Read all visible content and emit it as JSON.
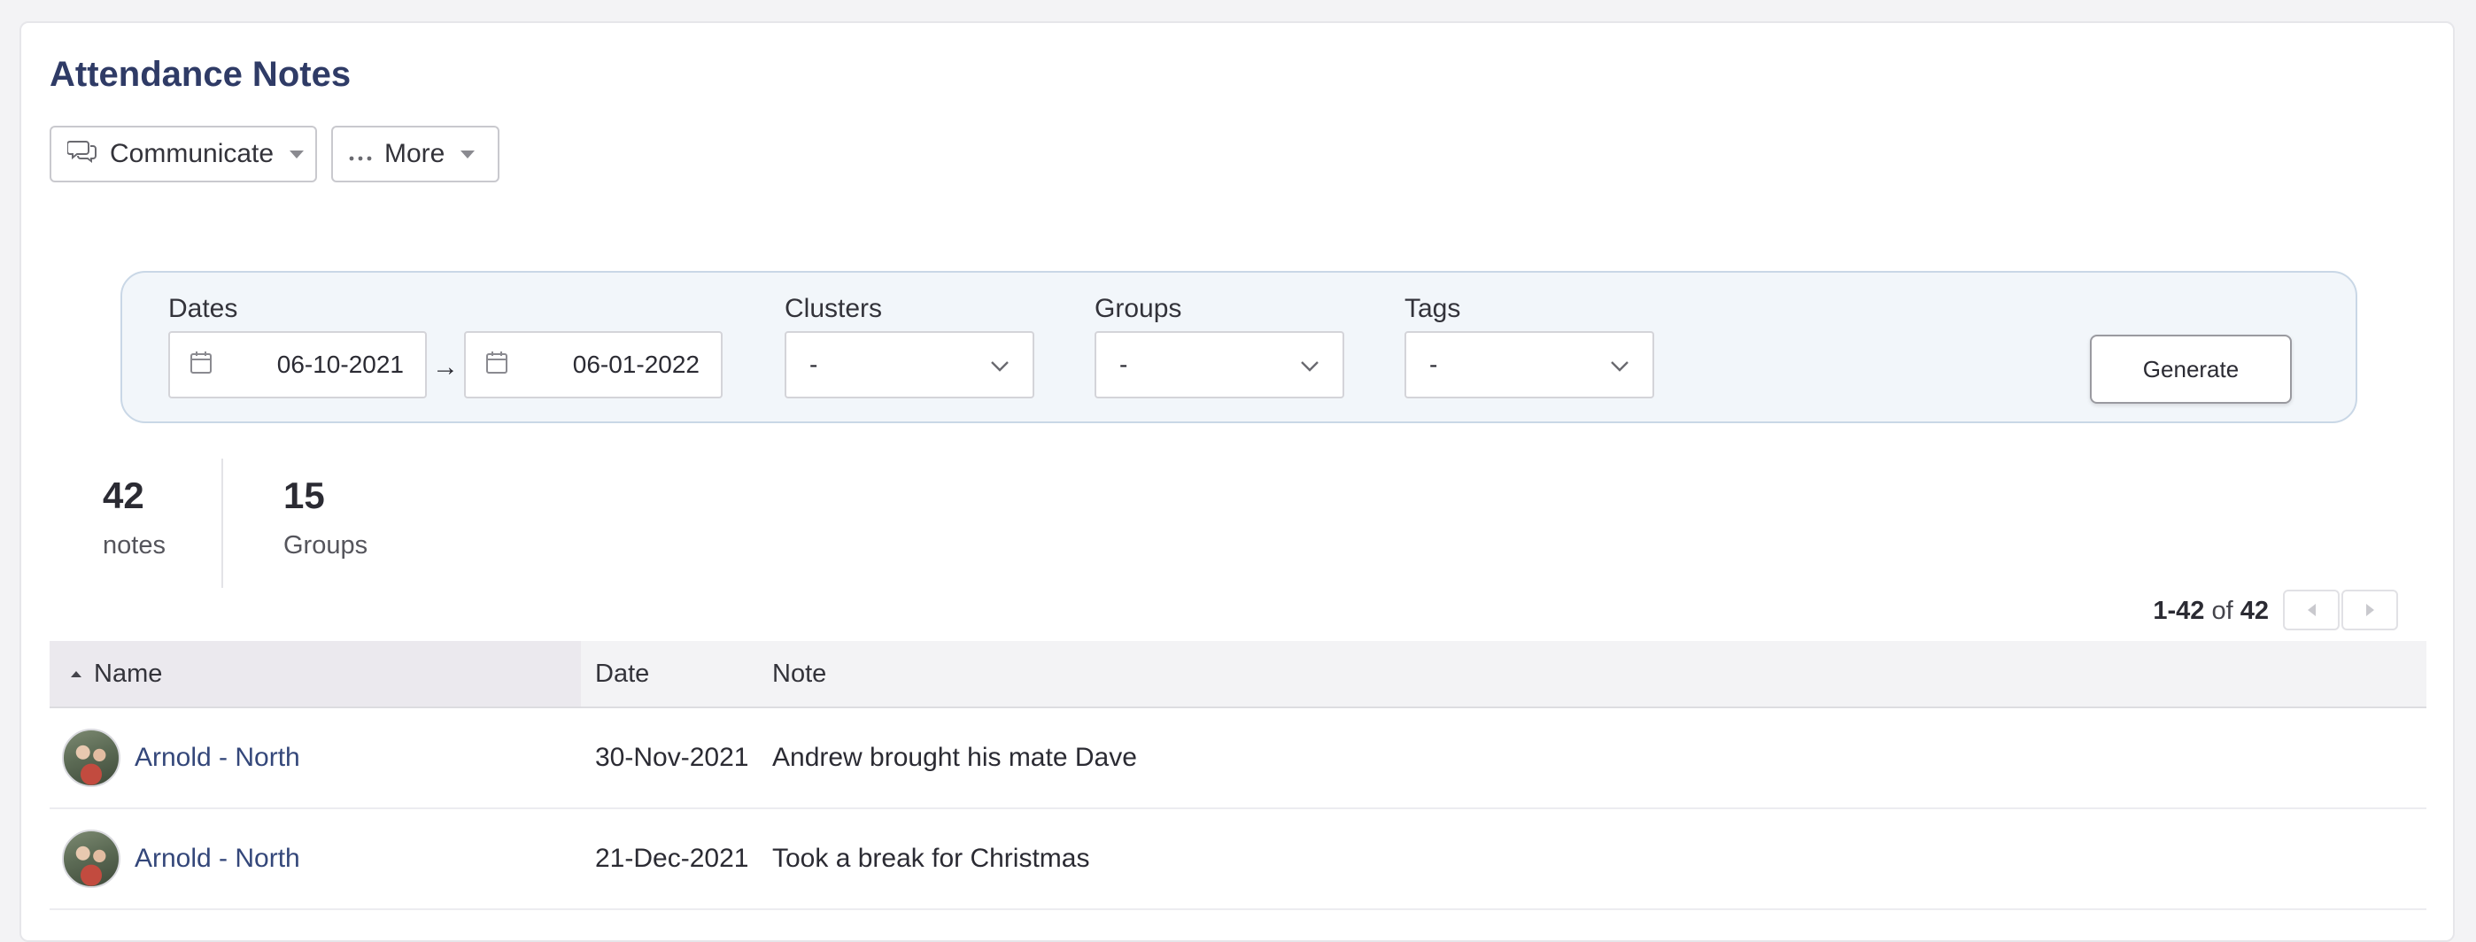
{
  "page": {
    "title": "Attendance Notes"
  },
  "toolbar": {
    "communicate_label": "Communicate",
    "more_label": "More"
  },
  "filters": {
    "dates_label": "Dates",
    "date_from": "06-10-2021",
    "date_to": "06-01-2022",
    "arrow": "→",
    "clusters_label": "Clusters",
    "clusters_value": "-",
    "groups_label": "Groups",
    "groups_value": "-",
    "tags_label": "Tags",
    "tags_value": "-",
    "generate_label": "Generate"
  },
  "stats": [
    {
      "value": "42",
      "label": "notes"
    },
    {
      "value": "15",
      "label": "Groups"
    }
  ],
  "pager": {
    "range": "1-42",
    "of": "of",
    "total": "42"
  },
  "table": {
    "columns": [
      "Name",
      "Date",
      "Note"
    ],
    "rows": [
      {
        "name": "Arnold - North",
        "date": "30-Nov-2021",
        "note": "Andrew brought his mate Dave"
      },
      {
        "name": "Arnold - North",
        "date": "21-Dec-2021",
        "note": "Took a break for Christmas"
      }
    ]
  },
  "icons": {
    "communicate": "chat-bubbles-icon",
    "more": "ellipsis-icon",
    "calendar": "calendar-icon",
    "dropdown": "chevron-down-icon",
    "sort": "sort-ascending-icon",
    "prev": "previous-page-icon",
    "next": "next-page-icon"
  },
  "colors": {
    "title": "#2f3b66",
    "link": "#34477a",
    "panel_bg": "#f2f6fa",
    "panel_border": "#c9d7e6"
  }
}
